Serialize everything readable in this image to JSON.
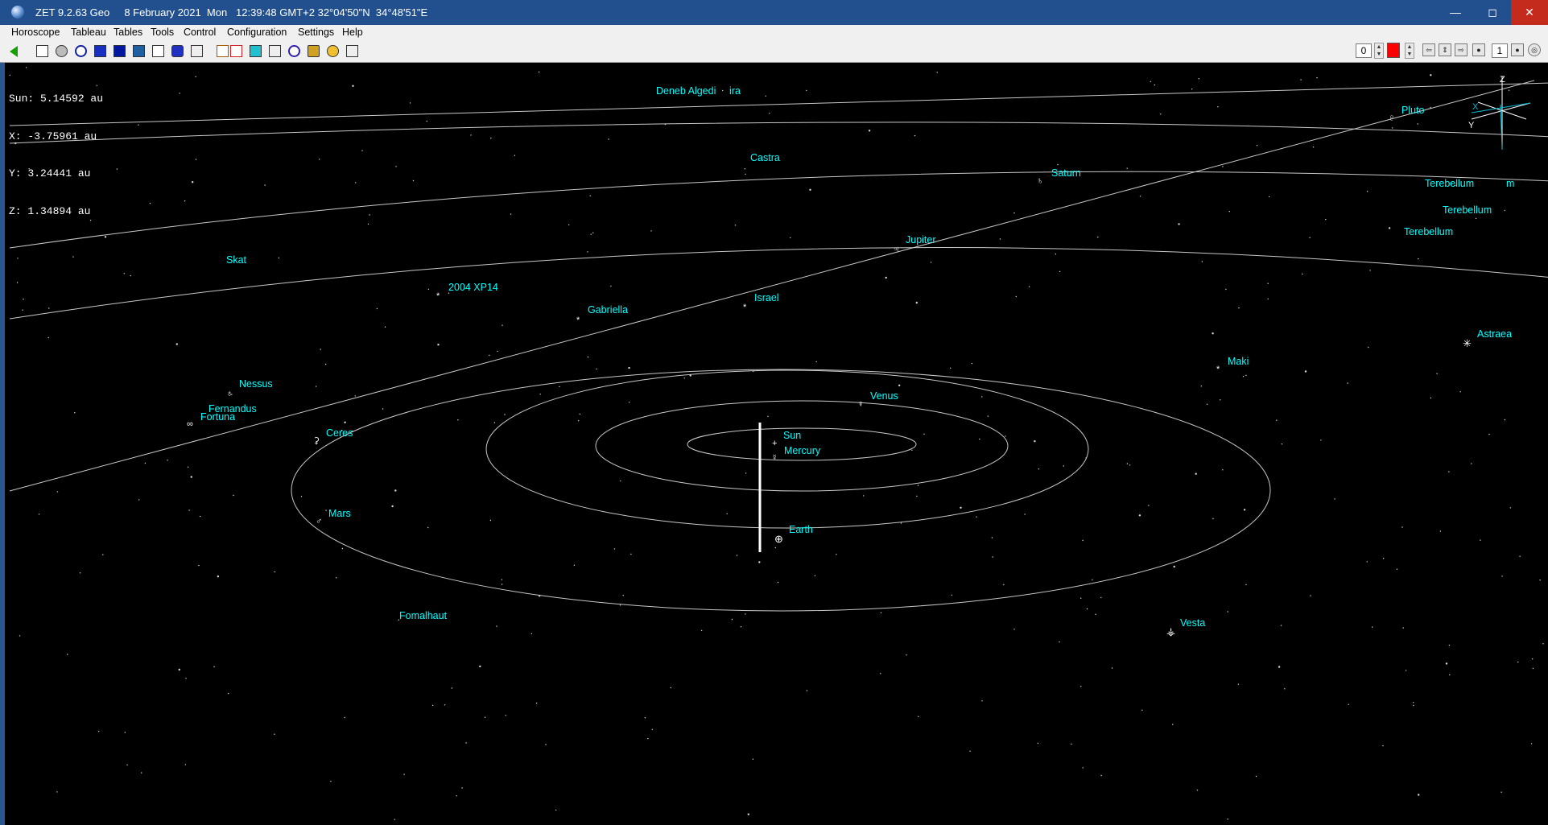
{
  "window": {
    "title": "ZET 9.2.63 Geo     8 February 2021  Mon   12:39:48 GMT+2 32°04'50\"N  34°48'51\"E",
    "controls": {
      "minimize": "—",
      "maximize": "◻",
      "close": "✕"
    }
  },
  "menu": [
    "Horoscope",
    "Tableau",
    "Tables",
    "Tools",
    "Control",
    "Configuration",
    "Settings",
    "Help"
  ],
  "toolbar": {
    "icons": [
      "back-arrow-icon",
      "table-icon",
      "globe-icon",
      "wheel-icon",
      "star-map-icon",
      "chart-grid-icon",
      "aspect-grid-icon",
      "atlas-icon",
      "magnet-icon",
      "page-icon",
      "cross-table-icon",
      "table-grid-icon",
      "color-cube-icon",
      "calendar-icon",
      "orbit-icon",
      "tools-icon",
      "person-icon",
      "figure-icon"
    ],
    "field_left_value": "0",
    "field_right_value": "1",
    "color_swatch": "#ff0000"
  },
  "readout": {
    "sun": "Sun: 5.14592 au",
    "x": "X: -3.75961 au",
    "y": "Y: 3.24441 au",
    "z": "Z: 1.34894 au"
  },
  "axes": {
    "z": "Z",
    "x": "X",
    "y": "Y"
  },
  "bodies": {
    "sun": {
      "label": "Sun",
      "symbol": "+"
    },
    "mercury": {
      "label": "Mercury",
      "symbol": "☿"
    },
    "venus": {
      "label": "Venus",
      "symbol": "♀"
    },
    "earth": {
      "label": "Earth",
      "symbol": "⊕"
    },
    "mars": {
      "label": "Mars",
      "symbol": "♂"
    },
    "ceres": {
      "label": "Ceres",
      "symbol": "⚳"
    },
    "jupiter": {
      "label": "Jupiter",
      "symbol": "♃"
    },
    "saturn": {
      "label": "Saturn",
      "symbol": "♄"
    },
    "pluto": {
      "label": "Pluto",
      "symbol": "♇"
    },
    "vesta": {
      "label": "Vesta",
      "symbol": "⚶"
    },
    "astraea": {
      "label": "Astraea",
      "symbol": "✳"
    },
    "nessus": {
      "label": "Nessus",
      "symbol": "♁"
    },
    "fortuna": {
      "label": "Fortuna",
      "symbol": "∞"
    },
    "fernandus": {
      "label": "Fernandus",
      "symbol": ""
    },
    "maki": {
      "label": "Maki",
      "symbol": "*"
    },
    "israel": {
      "label": "Israel",
      "symbol": "*"
    },
    "gabriella": {
      "label": "Gabriella",
      "symbol": "*"
    },
    "xp14": {
      "label": "2004 XP14",
      "symbol": "*"
    }
  },
  "stars": {
    "deneb_algedi": "Deneb Algedi",
    "ira": "ira",
    "castra": "Castra",
    "skat": "Skat",
    "fomalhaut": "Fomalhaut",
    "terebellum1": "Terebellum",
    "terebellum1_tail": "m",
    "terebellum2": "Terebellum",
    "terebellum3": "Terebellum"
  }
}
